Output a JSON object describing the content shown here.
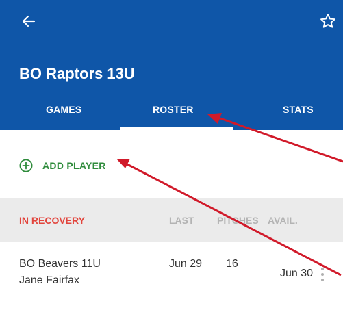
{
  "header": {
    "title": "BO Raptors 13U",
    "back_icon": "arrow-left-icon",
    "star_icon": "star-outline-icon"
  },
  "tabs": [
    {
      "label": "GAMES",
      "selected": false
    },
    {
      "label": "ROSTER",
      "selected": true
    },
    {
      "label": "STATS",
      "selected": false
    }
  ],
  "add_player": {
    "label": "ADD PLAYER",
    "icon": "plus-circle-icon"
  },
  "section": {
    "title": "IN RECOVERY",
    "columns": [
      "LAST",
      "PITCHES",
      "AVAIL."
    ]
  },
  "rows": [
    {
      "team": "BO Beavers 11U",
      "player": "Jane Fairfax",
      "last": "Jun 29",
      "pitches": "16",
      "avail": "Jun 30"
    }
  ],
  "colors": {
    "appbar": "#0f56a8",
    "add_player": "#2e8b3b",
    "recovery": "#e2453d",
    "annotation_arrow": "#d11a2a"
  }
}
